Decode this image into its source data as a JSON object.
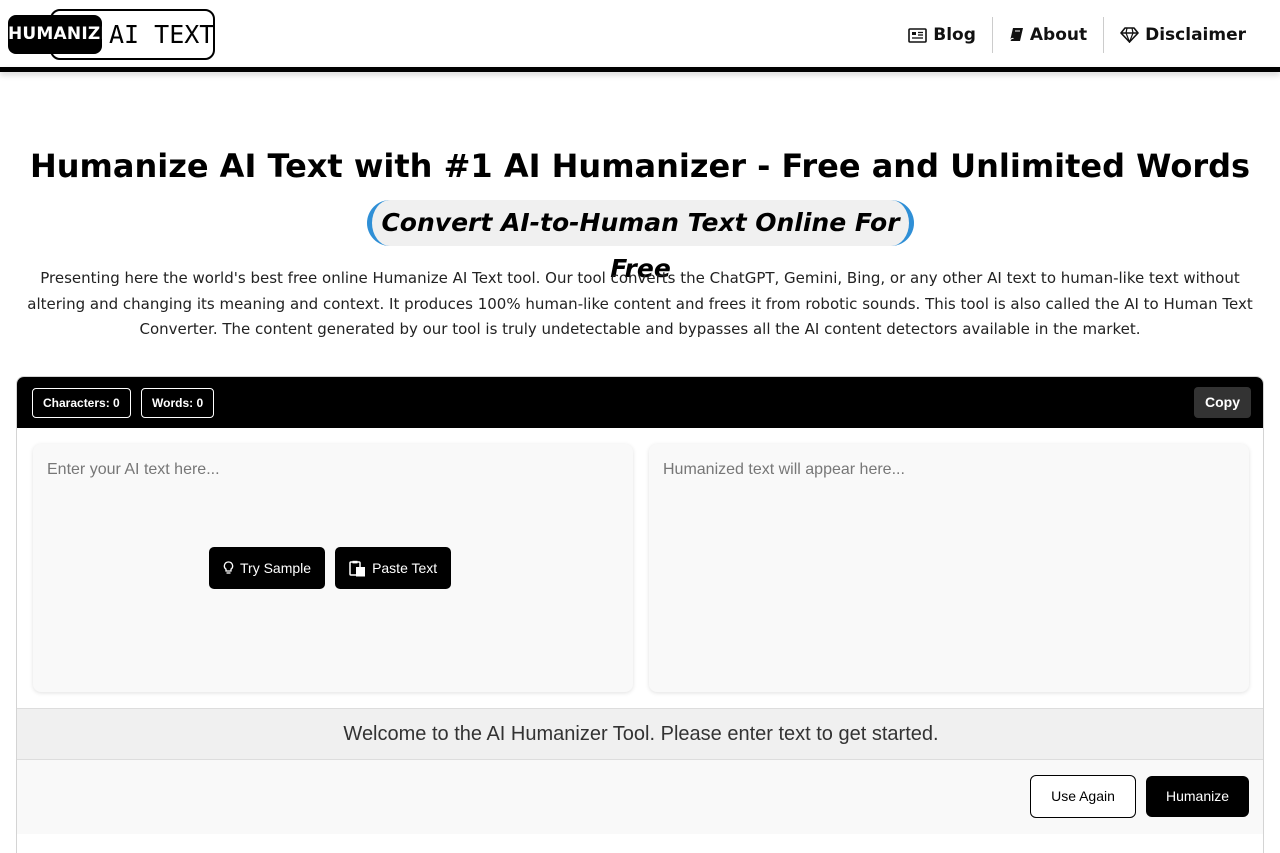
{
  "header": {
    "logo_badge": "HUMANIZE",
    "logo_text": "AI TEXT",
    "nav": [
      {
        "label": "Blog",
        "icon": "newspaper-icon"
      },
      {
        "label": "About",
        "icon": "book-icon"
      },
      {
        "label": "Disclaimer",
        "icon": "diamond-icon"
      }
    ]
  },
  "hero": {
    "title": "Humanize AI Text with #1 AI Humanizer - Free and Unlimited Words",
    "subtitle": "Convert AI-to-Human Text Online For Free",
    "description": "Presenting here the world's best free online Humanize AI Text tool. Our tool converts the ChatGPT, Gemini, Bing, or any other AI text to human-like text without altering and changing its meaning and context. It produces 100% human-like content and frees it from robotic sounds. This tool is also called the AI to Human Text Converter. The content generated by our tool is truly undetectable and bypasses all the AI content detectors available in the market."
  },
  "tool": {
    "characters_label": "Characters: 0",
    "words_label": "Words: 0",
    "copy_label": "Copy",
    "input_placeholder": "Enter your AI text here...",
    "output_placeholder": "Humanized text will appear here...",
    "try_sample_label": "Try Sample",
    "paste_text_label": "Paste Text",
    "status_message": "Welcome to the AI Humanizer Tool. Please enter text to get started.",
    "use_again_label": "Use Again",
    "humanize_label": "Humanize"
  },
  "colors": {
    "accent": "#2f8fd6",
    "primary": "#000000",
    "status_bg": "#f0f0f0"
  }
}
